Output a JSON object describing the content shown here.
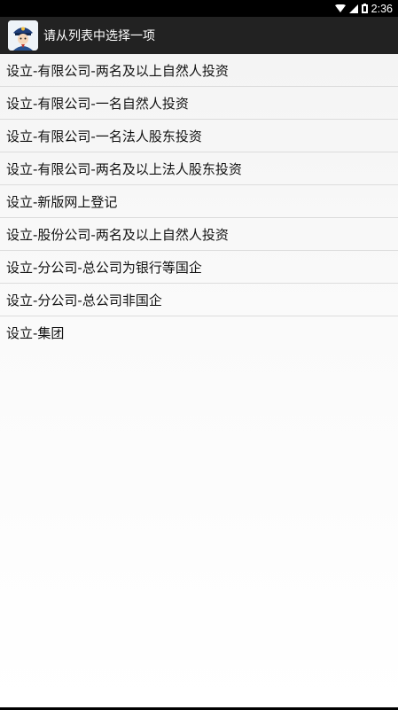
{
  "status_bar": {
    "time": "2:36",
    "icons": [
      "wifi-icon",
      "signal-icon",
      "battery-icon"
    ]
  },
  "action_bar": {
    "app_icon": "police-avatar-icon",
    "title": "请从列表中选择一项"
  },
  "list": {
    "items": [
      "设立-有限公司-两名及以上自然人投资",
      "设立-有限公司-一名自然人投资",
      "设立-有限公司-一名法人股东投资",
      "设立-有限公司-两名及以上法人股东投资",
      "设立-新版网上登记",
      "设立-股份公司-两名及以上自然人投资",
      "设立-分公司-总公司为银行等国企",
      "设立-分公司-总公司非国企",
      "设立-集团"
    ]
  },
  "colors": {
    "status_bar_bg": "#000000",
    "action_bar_bg": "#222222",
    "divider": "#dcdcdc"
  }
}
